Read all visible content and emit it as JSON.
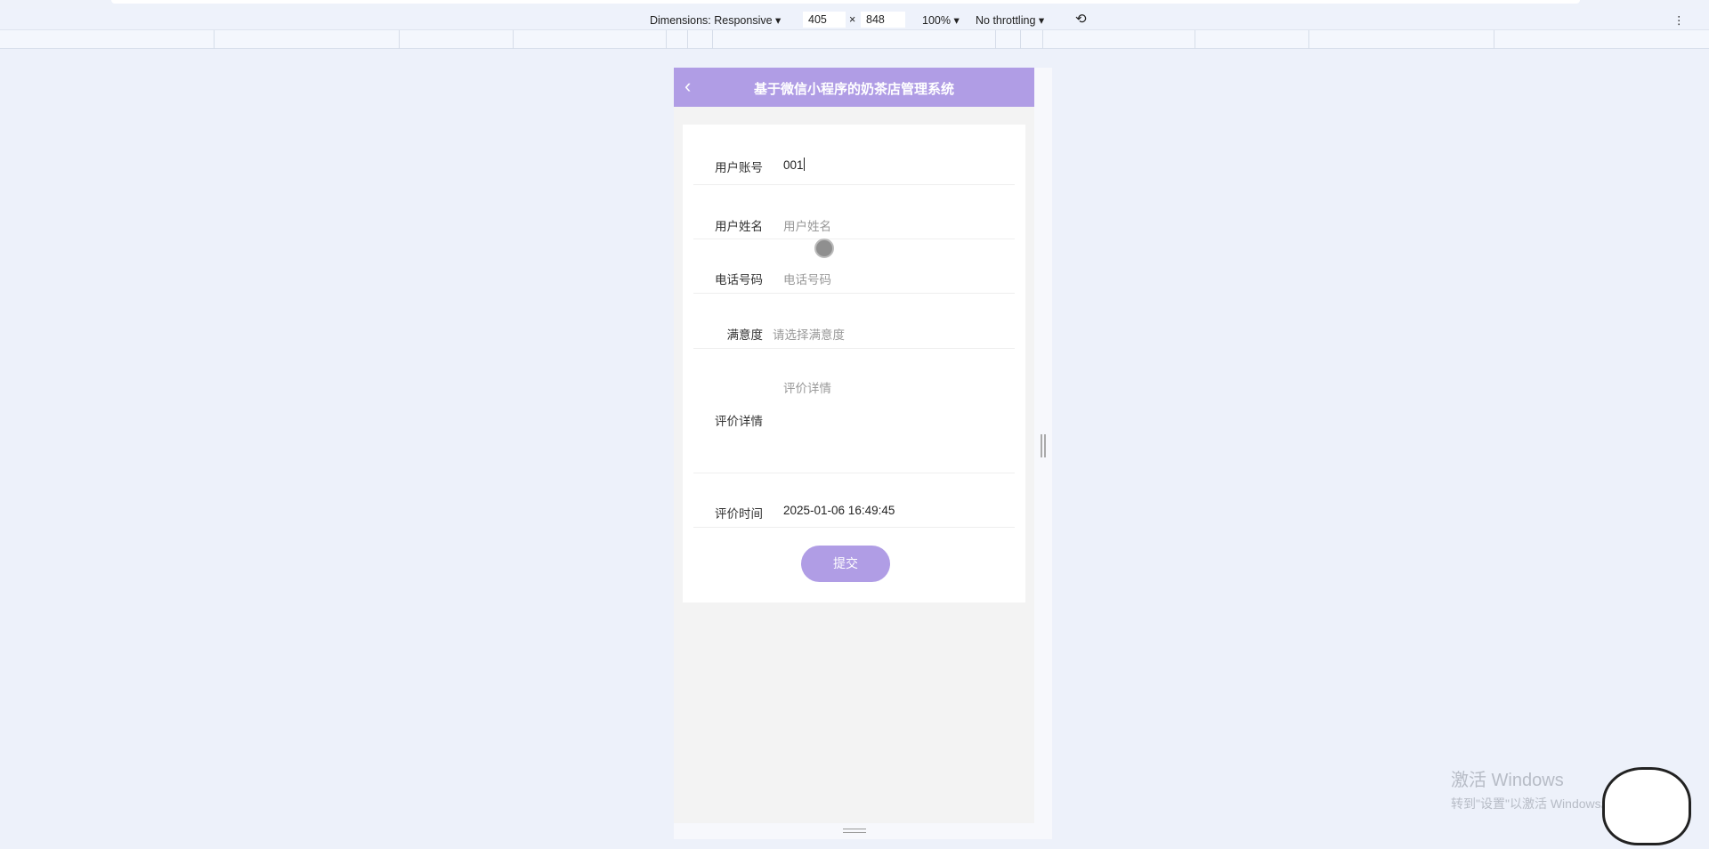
{
  "devtools": {
    "dimensions_label": "Dimensions: Responsive ▾",
    "width": "405",
    "times": "×",
    "height": "848",
    "zoom": "100% ▾",
    "throttling": "No throttling ▾",
    "rotate_icon": "rotate-icon",
    "more_icon": "⋮"
  },
  "app": {
    "title": "基于微信小程序的奶茶店管理系统",
    "back_icon": "‹",
    "accent": "#b09de5"
  },
  "form": {
    "fields": [
      {
        "label": "用户账号",
        "value": "001",
        "placeholder": ""
      },
      {
        "label": "用户姓名",
        "value": "",
        "placeholder": "用户姓名"
      },
      {
        "label": "电话号码",
        "value": "",
        "placeholder": "电话号码"
      },
      {
        "label": "满意度",
        "value": "",
        "placeholder": "请选择满意度"
      },
      {
        "label": "评价详情",
        "value": "",
        "placeholder": "评价详情"
      },
      {
        "label": "评价时间",
        "value": "2025-01-06 16:49:45",
        "placeholder": ""
      }
    ],
    "submit_label": "提交"
  },
  "watermark": {
    "line1": "激活 Windows",
    "line2": "转到\"设置\"以激活 Windows。"
  }
}
